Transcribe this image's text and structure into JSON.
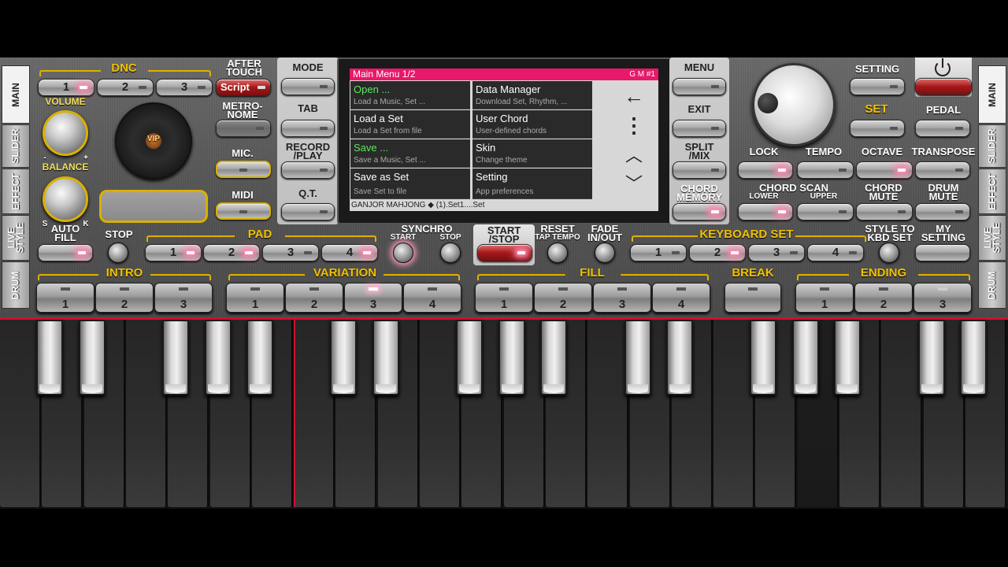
{
  "side_tabs_left": [
    "MAIN",
    "SLIDER",
    "EFFECT",
    "LIVE\nSTYLE",
    "DRUM"
  ],
  "side_tabs_right": [
    "MAIN",
    "SLIDER",
    "EFFECT",
    "LIVE\nSTYLE",
    "DRUM"
  ],
  "dnc": {
    "label": "DNC",
    "buttons": [
      "1",
      "2",
      "3"
    ]
  },
  "after_touch": {
    "label": "AFTER\nTOUCH",
    "button": "Script"
  },
  "volume_label": "VOLUME",
  "balance": {
    "label": "BALANCE",
    "minus": "-",
    "plus": "+",
    "left": "S",
    "right": "K"
  },
  "metronome_label": "METRO-\nNOME",
  "mic_label": "MIC.",
  "midi_label": "MIDI",
  "vip_label": "VIP",
  "mode_label": "MODE",
  "tab_label": "TAB",
  "record_label": "RECORD\n/PLAY",
  "qt_label": "Q.T.",
  "menu_label": "MENU",
  "exit_label": "EXIT",
  "split_label": "SPLIT\n/MIX",
  "chord_memory_label": "CHORD\nMEMORY",
  "setting_label": "SETTING",
  "set_label": "SET",
  "pedal_label": "PEDAL",
  "lock_label": "LOCK",
  "tempo_label": "TEMPO",
  "octave_label": "OCTAVE",
  "transpose_label": "TRANSPOSE",
  "chord_scan": {
    "label": "CHORD SCAN",
    "lower": "LOWER",
    "upper": "UPPER"
  },
  "chord_mute_label": "CHORD\nMUTE",
  "drum_mute_label": "DRUM\nMUTE",
  "lcd": {
    "title": "Main Menu  1/2",
    "title_right": "G M #1",
    "items": [
      {
        "title": "Open ...",
        "sub": "Load a Music, Set ..."
      },
      {
        "title": "Data Manager",
        "sub": "Download Set, Rhythm, ..."
      },
      {
        "title": "Load a Set",
        "sub": "Load a Set from file"
      },
      {
        "title": "User Chord",
        "sub": "User-defined chords"
      },
      {
        "title": "Save ...",
        "sub": "Save a Music, Set ..."
      },
      {
        "title": "Skin",
        "sub": "Change theme"
      },
      {
        "title": "Save as Set",
        "sub": "Save Set to file"
      },
      {
        "title": "Setting",
        "sub": "App preferences"
      }
    ],
    "nav": {
      "back": "←",
      "more": "⋮",
      "up": "︿",
      "down": "﹀"
    },
    "status": "GANJOR MAHJONG  ◆  (1).Set1....Set"
  },
  "auto_fill_label": "AUTO\nFILL",
  "stop_label": "STOP",
  "pad": {
    "label": "PAD",
    "buttons": [
      "1",
      "2",
      "3",
      "4"
    ]
  },
  "synchro": {
    "label": "SYNCHRO",
    "start": "START",
    "stop": "STOP"
  },
  "start_stop_label": "START\n/STOP",
  "reset": {
    "label": "RESET",
    "sub": "TAP TEMPO"
  },
  "fade_label": "FADE\nIN/OUT",
  "keyboard_set": {
    "label": "KEYBOARD SET",
    "buttons": [
      "1",
      "2",
      "3",
      "4"
    ]
  },
  "style_to_kbd_label": "STYLE TO\nKBD SET",
  "my_setting_label": "MY\nSETTING",
  "intro": {
    "label": "INTRO",
    "buttons": [
      "1",
      "2",
      "3"
    ]
  },
  "variation": {
    "label": "VARIATION",
    "buttons": [
      "1",
      "2",
      "3",
      "4"
    ]
  },
  "fill": {
    "label": "FILL",
    "buttons": [
      "1",
      "2",
      "3",
      "4"
    ]
  },
  "break_label": "BREAK",
  "ending": {
    "label": "ENDING",
    "buttons": [
      "1",
      "2",
      "3"
    ]
  },
  "colors": {
    "accent_gold": "#e0b000",
    "lcd_title": "#e8186a",
    "highlight_green": "#5be85b",
    "split_line": "#d01030"
  }
}
